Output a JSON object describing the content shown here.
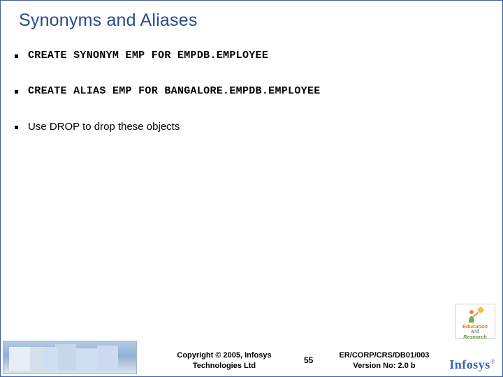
{
  "title": "Synonyms and Aliases",
  "bullets": [
    {
      "text": "CREATE SYNONYM EMP FOR EMPDB.EMPLOYEE",
      "mono": true
    },
    {
      "text": "CREATE ALIAS EMP FOR BANGALORE.EMPDB.EMPLOYEE",
      "mono": true
    },
    {
      "text": "Use DROP to drop these objects",
      "mono": false
    }
  ],
  "footer": {
    "copyright_line1": "Copyright © 2005, Infosys",
    "copyright_line2": "Technologies Ltd",
    "page_number": "55",
    "doc_id": "ER/CORP/CRS/DB01/003",
    "version": "Version No: 2.0 b",
    "logo_text": "Infosys",
    "logo_reg": "®",
    "edu_line1": "Education",
    "edu_and": "and",
    "edu_line2": "Research"
  }
}
